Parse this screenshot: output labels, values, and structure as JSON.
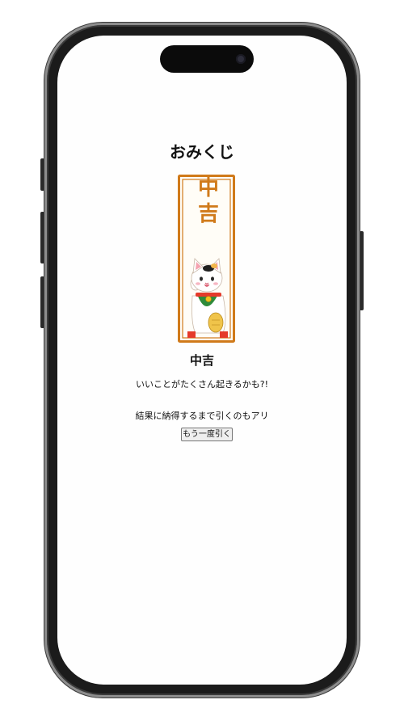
{
  "page": {
    "title": "おみくじ"
  },
  "result": {
    "fortune": "中吉",
    "slip_text": "中吉",
    "message": "いいことがたくさん起きるかも?!"
  },
  "hint": "結果に納得するまで引くのもアリ",
  "actions": {
    "redraw_label": "もう一度引く"
  },
  "colors": {
    "slip_border": "#d07a1a",
    "slip_text": "#d07a1a",
    "cat_collar": "#e53a2a",
    "cat_bib": "#2e8b3a"
  },
  "icons": {
    "omikuji_illustration": "maneki-neko-omikuji-slip"
  }
}
